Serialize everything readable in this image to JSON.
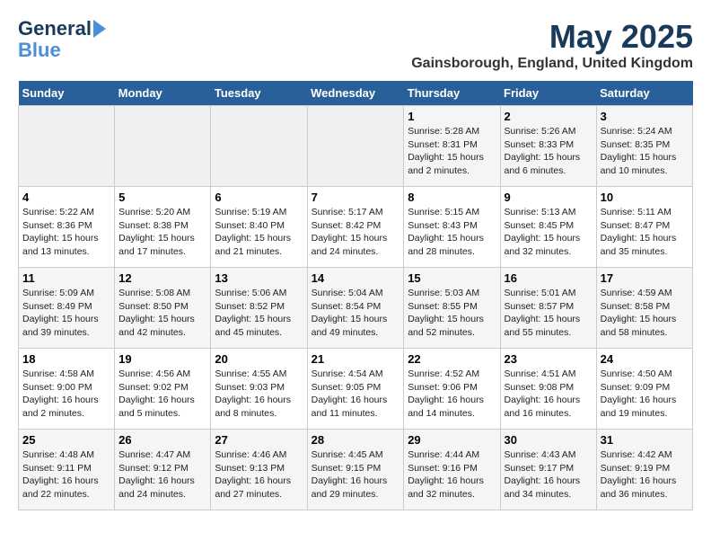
{
  "header": {
    "logo_line1": "General",
    "logo_line2": "Blue",
    "month": "May 2025",
    "location": "Gainsborough, England, United Kingdom"
  },
  "weekdays": [
    "Sunday",
    "Monday",
    "Tuesday",
    "Wednesday",
    "Thursday",
    "Friday",
    "Saturday"
  ],
  "weeks": [
    [
      {
        "day": "",
        "info": "",
        "empty": true
      },
      {
        "day": "",
        "info": "",
        "empty": true
      },
      {
        "day": "",
        "info": "",
        "empty": true
      },
      {
        "day": "",
        "info": "",
        "empty": true
      },
      {
        "day": "1",
        "info": "Sunrise: 5:28 AM\nSunset: 8:31 PM\nDaylight: 15 hours\nand 2 minutes."
      },
      {
        "day": "2",
        "info": "Sunrise: 5:26 AM\nSunset: 8:33 PM\nDaylight: 15 hours\nand 6 minutes."
      },
      {
        "day": "3",
        "info": "Sunrise: 5:24 AM\nSunset: 8:35 PM\nDaylight: 15 hours\nand 10 minutes."
      }
    ],
    [
      {
        "day": "4",
        "info": "Sunrise: 5:22 AM\nSunset: 8:36 PM\nDaylight: 15 hours\nand 13 minutes."
      },
      {
        "day": "5",
        "info": "Sunrise: 5:20 AM\nSunset: 8:38 PM\nDaylight: 15 hours\nand 17 minutes."
      },
      {
        "day": "6",
        "info": "Sunrise: 5:19 AM\nSunset: 8:40 PM\nDaylight: 15 hours\nand 21 minutes."
      },
      {
        "day": "7",
        "info": "Sunrise: 5:17 AM\nSunset: 8:42 PM\nDaylight: 15 hours\nand 24 minutes."
      },
      {
        "day": "8",
        "info": "Sunrise: 5:15 AM\nSunset: 8:43 PM\nDaylight: 15 hours\nand 28 minutes."
      },
      {
        "day": "9",
        "info": "Sunrise: 5:13 AM\nSunset: 8:45 PM\nDaylight: 15 hours\nand 32 minutes."
      },
      {
        "day": "10",
        "info": "Sunrise: 5:11 AM\nSunset: 8:47 PM\nDaylight: 15 hours\nand 35 minutes."
      }
    ],
    [
      {
        "day": "11",
        "info": "Sunrise: 5:09 AM\nSunset: 8:49 PM\nDaylight: 15 hours\nand 39 minutes."
      },
      {
        "day": "12",
        "info": "Sunrise: 5:08 AM\nSunset: 8:50 PM\nDaylight: 15 hours\nand 42 minutes."
      },
      {
        "day": "13",
        "info": "Sunrise: 5:06 AM\nSunset: 8:52 PM\nDaylight: 15 hours\nand 45 minutes."
      },
      {
        "day": "14",
        "info": "Sunrise: 5:04 AM\nSunset: 8:54 PM\nDaylight: 15 hours\nand 49 minutes."
      },
      {
        "day": "15",
        "info": "Sunrise: 5:03 AM\nSunset: 8:55 PM\nDaylight: 15 hours\nand 52 minutes."
      },
      {
        "day": "16",
        "info": "Sunrise: 5:01 AM\nSunset: 8:57 PM\nDaylight: 15 hours\nand 55 minutes."
      },
      {
        "day": "17",
        "info": "Sunrise: 4:59 AM\nSunset: 8:58 PM\nDaylight: 15 hours\nand 58 minutes."
      }
    ],
    [
      {
        "day": "18",
        "info": "Sunrise: 4:58 AM\nSunset: 9:00 PM\nDaylight: 16 hours\nand 2 minutes."
      },
      {
        "day": "19",
        "info": "Sunrise: 4:56 AM\nSunset: 9:02 PM\nDaylight: 16 hours\nand 5 minutes."
      },
      {
        "day": "20",
        "info": "Sunrise: 4:55 AM\nSunset: 9:03 PM\nDaylight: 16 hours\nand 8 minutes."
      },
      {
        "day": "21",
        "info": "Sunrise: 4:54 AM\nSunset: 9:05 PM\nDaylight: 16 hours\nand 11 minutes."
      },
      {
        "day": "22",
        "info": "Sunrise: 4:52 AM\nSunset: 9:06 PM\nDaylight: 16 hours\nand 14 minutes."
      },
      {
        "day": "23",
        "info": "Sunrise: 4:51 AM\nSunset: 9:08 PM\nDaylight: 16 hours\nand 16 minutes."
      },
      {
        "day": "24",
        "info": "Sunrise: 4:50 AM\nSunset: 9:09 PM\nDaylight: 16 hours\nand 19 minutes."
      }
    ],
    [
      {
        "day": "25",
        "info": "Sunrise: 4:48 AM\nSunset: 9:11 PM\nDaylight: 16 hours\nand 22 minutes."
      },
      {
        "day": "26",
        "info": "Sunrise: 4:47 AM\nSunset: 9:12 PM\nDaylight: 16 hours\nand 24 minutes."
      },
      {
        "day": "27",
        "info": "Sunrise: 4:46 AM\nSunset: 9:13 PM\nDaylight: 16 hours\nand 27 minutes."
      },
      {
        "day": "28",
        "info": "Sunrise: 4:45 AM\nSunset: 9:15 PM\nDaylight: 16 hours\nand 29 minutes."
      },
      {
        "day": "29",
        "info": "Sunrise: 4:44 AM\nSunset: 9:16 PM\nDaylight: 16 hours\nand 32 minutes."
      },
      {
        "day": "30",
        "info": "Sunrise: 4:43 AM\nSunset: 9:17 PM\nDaylight: 16 hours\nand 34 minutes."
      },
      {
        "day": "31",
        "info": "Sunrise: 4:42 AM\nSunset: 9:19 PM\nDaylight: 16 hours\nand 36 minutes."
      }
    ]
  ]
}
